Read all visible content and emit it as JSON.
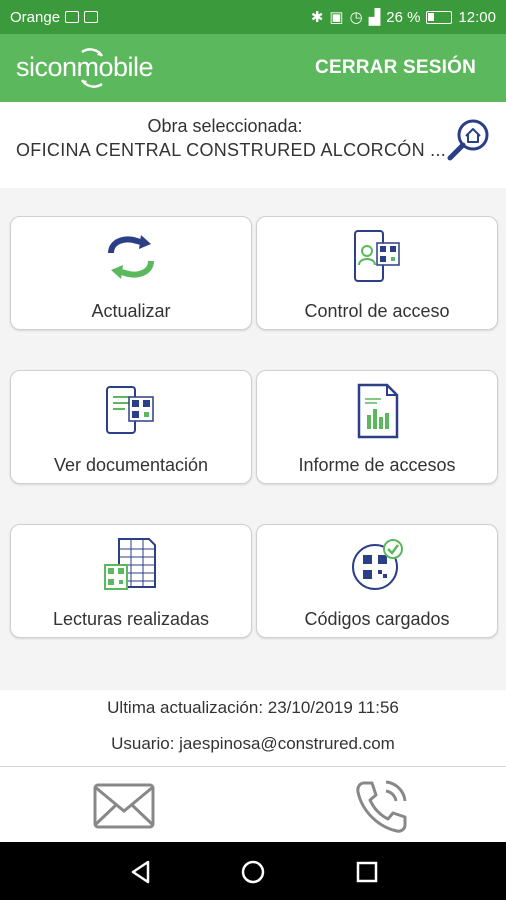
{
  "status_bar": {
    "carrier": "Orange",
    "battery": "26 %",
    "time": "12:00"
  },
  "app_bar": {
    "logo": "siconmobile",
    "logout_label": "CERRAR SESIÓN"
  },
  "obra": {
    "label": "Obra seleccionada:",
    "name": "OFICINA CENTRAL CONSTRURED ALCORCÓN ..."
  },
  "tiles": [
    {
      "label": "Actualizar",
      "icon": "sync-icon"
    },
    {
      "label": "Control de acceso",
      "icon": "phone-qr-user-icon"
    },
    {
      "label": "Ver documentación",
      "icon": "phone-qr-document-icon"
    },
    {
      "label": "Informe de accesos",
      "icon": "report-chart-icon"
    },
    {
      "label": "Lecturas realizadas",
      "icon": "spreadsheet-qr-icon"
    },
    {
      "label": "Códigos cargados",
      "icon": "qr-check-icon"
    }
  ],
  "info": {
    "last_update": "Ultima actualización: 23/10/2019 11:56",
    "user": "Usuario: jaespinosa@construred.com"
  },
  "colors": {
    "primary_green": "#5cb85c",
    "status_green": "#3b9a3b",
    "icon_navy": "#2b3f86",
    "icon_green": "#5cb85c"
  }
}
